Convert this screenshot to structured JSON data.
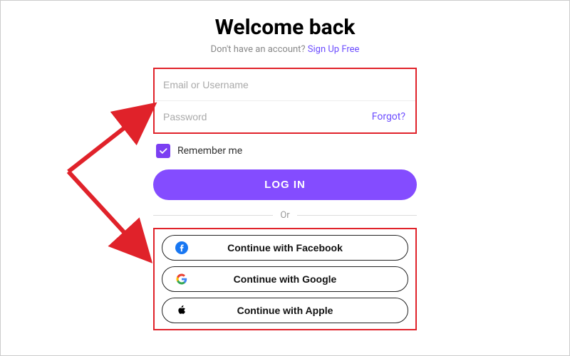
{
  "header": {
    "title": "Welcome back",
    "subtitle_prefix": "Don't have an account? ",
    "signup_link": "Sign Up Free"
  },
  "form": {
    "email_placeholder": "Email or Username",
    "password_placeholder": "Password",
    "forgot_label": "Forgot?",
    "remember_label": "Remember me",
    "remember_checked": true,
    "login_label": "LOG IN"
  },
  "divider": {
    "label": "Or"
  },
  "social": {
    "facebook_label": "Continue with Facebook",
    "google_label": "Continue with Google",
    "apple_label": "Continue with Apple"
  },
  "colors": {
    "accent": "#844cff",
    "highlight_box": "#e0222a",
    "link": "#6c4cff"
  }
}
